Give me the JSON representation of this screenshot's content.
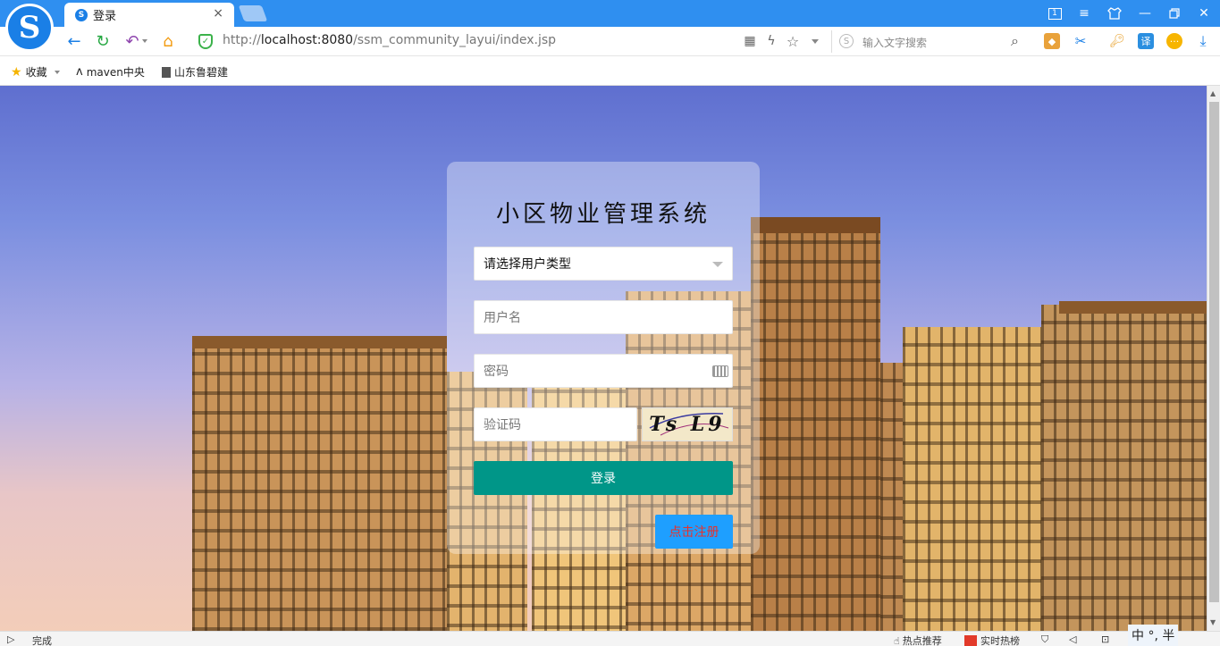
{
  "browser": {
    "tab_title": "登录",
    "tab_close": "×",
    "logo_letter": "S",
    "url_prefix": "http://",
    "url_host": "localhost:8080",
    "url_path": "/ssm_community_layui/index.jsp",
    "search_placeholder": "输入文字搜索",
    "bookmarks": [
      {
        "label": "收藏",
        "icon": "star-icon"
      },
      {
        "label": "maven中央",
        "icon": "maven-icon"
      },
      {
        "label": "山东鲁碧建",
        "icon": "document-icon"
      }
    ],
    "status_text": "完成",
    "status_right": [
      "热点推荐",
      "实时热榜"
    ],
    "ime_text": "中 °, 半"
  },
  "login": {
    "title": "小区物业管理系统",
    "user_type_select": "请选择用户类型",
    "username_placeholder": "用户名",
    "password_placeholder": "密码",
    "captcha_placeholder": "验证码",
    "captcha_text": "Ts L9",
    "login_button": "登录",
    "register_button": "点击注册"
  },
  "colors": {
    "login_button": "#009688",
    "register_button": "#1e9fff",
    "register_text": "#e8302a",
    "tabstrip": "#2f8ff0"
  }
}
